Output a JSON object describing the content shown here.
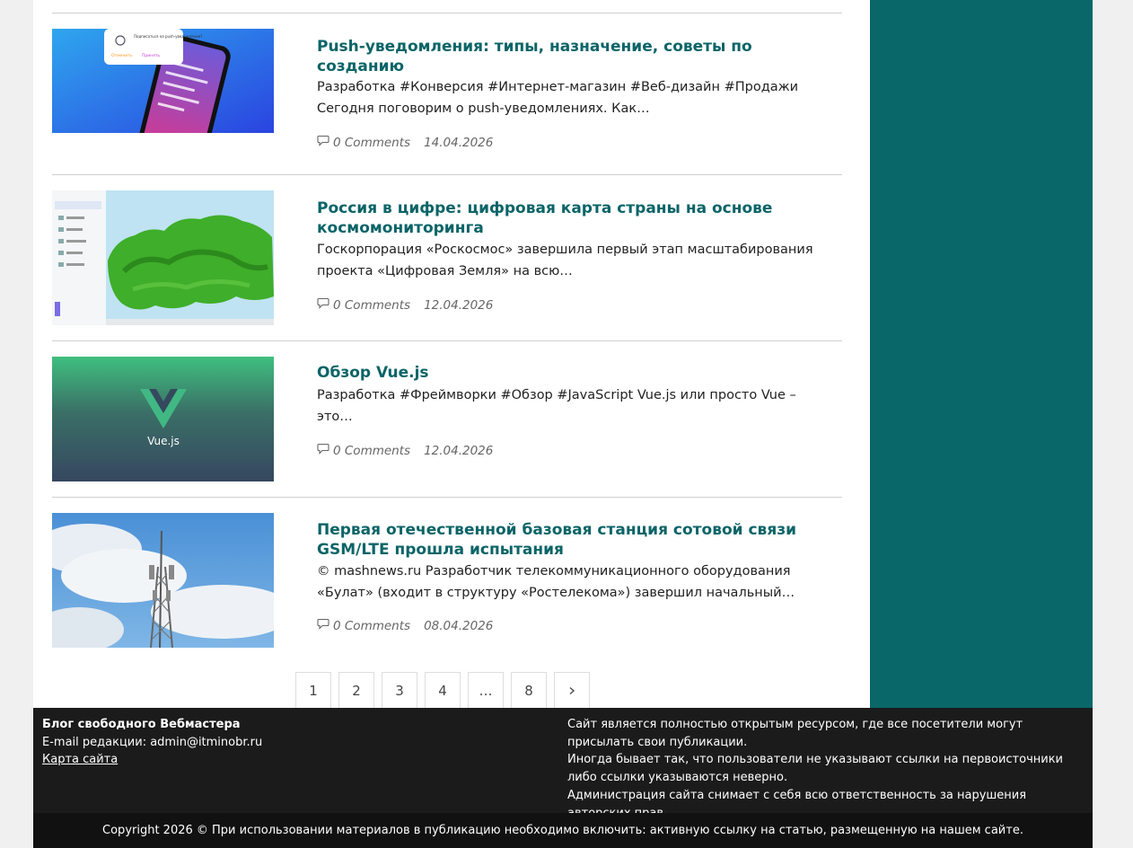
{
  "posts": [
    {
      "title": "Push-уведомления: типы, назначение, советы по созданию",
      "excerpt": "Разработка #Конверсия #Интернет-магазин #Веб-дизайн #Продажи Сегодня поговорим о push-уведомлениях. Как…",
      "comments": "0 Comments",
      "date": "14.04.2026",
      "thumb": {
        "type": "phone-push",
        "bg": "#2d6ef0",
        "card_text": "Подписаться на push-уведомления?",
        "cancel": "Отменить",
        "accept": "Принять"
      }
    },
    {
      "title": "Россия в цифре: цифровая карта страны на основе космомониторинга",
      "excerpt": "Госкорпорация «Роскосмос» завершила первый этап масштабирования проекта «Цифровая Земля» на всю…",
      "comments": "0 Comments",
      "date": "12.04.2026",
      "thumb": {
        "type": "map",
        "bg": "#bfe3f2"
      }
    },
    {
      "title": "Обзор Vue.js",
      "excerpt": "Разработка #Фреймворки #Обзор #JavaScript Vue.js или просто Vue – это…",
      "comments": "0 Comments",
      "date": "12.04.2026",
      "thumb": {
        "type": "vue-logo",
        "logo_text": "Vue.js",
        "bg": "#37485c"
      }
    },
    {
      "title": "Первая отечественной базовая станция сотовой связи GSM/LTE прошла испытания",
      "excerpt": " © mashnews.ru Разработчик телекоммуникационного оборудования «Булат» (входит в структуру «Ростелекома») завершил начальный…",
      "comments": "0 Comments",
      "date": "08.04.2026",
      "thumb": {
        "type": "cell-tower",
        "bg": "#5b9fd6"
      }
    }
  ],
  "pagination": {
    "pages": [
      "1",
      "2",
      "3",
      "4",
      "…",
      "8"
    ],
    "next_icon": "chevron-right-icon"
  },
  "footer": {
    "site_name": "Блог свободного Вебмастера",
    "email_line": "E-mail редакции: admin@itminobr.ru",
    "sitemap_link": "Карта сайта",
    "disclaimer_1": "Сайт является полностью открытым ресурсом, где все посетители могут присылать свои публикации.",
    "disclaimer_2": "Иногда бывает так, что пользователи не указывают ссылки на первоисточники либо ссылки указываются неверно.",
    "disclaimer_3": "Администрация сайта снимает с себя всю ответственность за нарушения авторских прав."
  },
  "copyright": "Copyright 2026 © При использовании материалов в публикацию необходимо включить: активную ссылку на статью, размещенную на нашем сайте.",
  "colors": {
    "accent": "#0b6467",
    "sidebar": "#09676a",
    "footer_bg": "#1b1b1b",
    "copyright_bg": "#111111"
  }
}
